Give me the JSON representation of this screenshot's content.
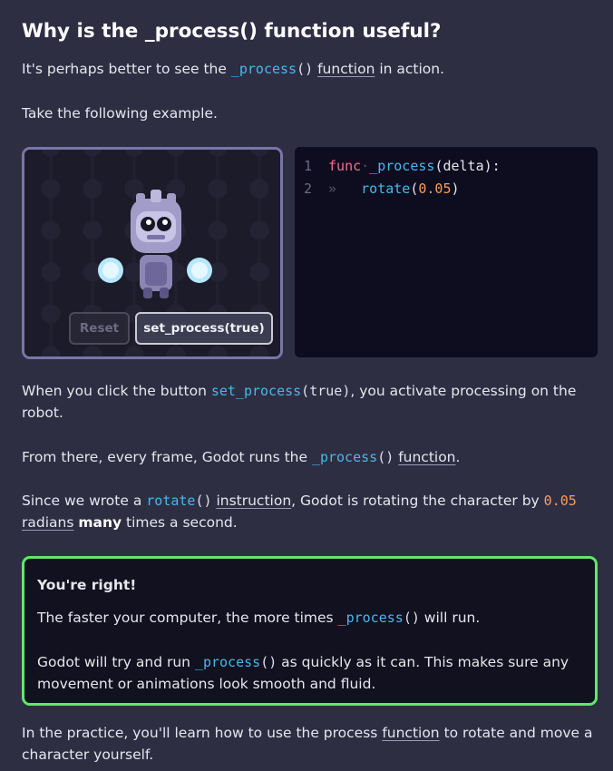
{
  "heading": "Why is the _process() function useful?",
  "intro": {
    "text_before": "It's perhaps better to see the ",
    "code_ident": "_process",
    "code_paren": "()",
    "space": " ",
    "link": "function",
    "text_after": " in action."
  },
  "example_intro": "Take the following example.",
  "demo": {
    "reset_label": "Reset",
    "process_label": "set_process(true)"
  },
  "editor": {
    "lines": [
      {
        "num": "1",
        "kw": "func",
        "ws": "·",
        "ident": "_process",
        "rest": "(delta):"
      },
      {
        "num": "2",
        "ws": "»",
        "indent": "   ",
        "ident": "rotate",
        "open": "(",
        "num_val": "0.05",
        "close": ")"
      }
    ]
  },
  "para_click": {
    "text_before": "When you click the button ",
    "code_ident": "set_process",
    "code_paren": "(true)",
    "text_after": ", you activate processing on the robot."
  },
  "para_frame": {
    "text_before": "From there, every frame, Godot runs the ",
    "code_ident": "_process",
    "code_paren": "()",
    "space": " ",
    "link": "function",
    "text_after": "."
  },
  "para_rotate": {
    "text_before": "Since we wrote a ",
    "code_ident": "rotate",
    "code_paren": "()",
    "space": " ",
    "link_instruction": "instruction",
    "text_mid": ", Godot is rotating the character by ",
    "num": "0.05",
    "link_radians": "radians",
    "bold": "many",
    "text_after": " times a second."
  },
  "callout": {
    "title": "You're right!",
    "p1_before": "The faster your computer, the more times ",
    "p1_ident": "_process",
    "p1_paren": "()",
    "p1_after": " will run.",
    "p2_before": "Godot will try and run ",
    "p2_ident": "_process",
    "p2_paren": "()",
    "p2_after": " as quickly as it can. This makes sure any movement or animations look smooth and fluid."
  },
  "para_practice": {
    "text_before": "In the practice, you'll learn how to use the process ",
    "link": "function",
    "text_after": " to rotate and move a character yourself."
  },
  "colors": {
    "background": "#2e2e43",
    "callout_border": "#5fe86a",
    "code_identifier": "#47b8ea",
    "code_number": "#f59f5b",
    "code_keyword": "#f26f86"
  }
}
